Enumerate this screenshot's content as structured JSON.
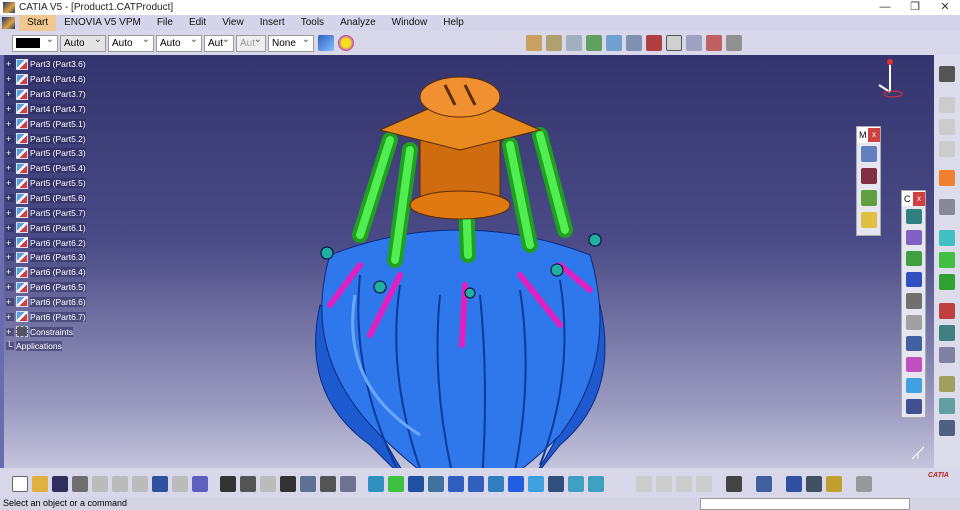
{
  "window": {
    "title": "CATIA V5 - [Product1.CATProduct]",
    "controls": [
      "—",
      "❐",
      "✕"
    ]
  },
  "menu": [
    "Start",
    "ENOVIA V5 VPM",
    "File",
    "Edit",
    "View",
    "Insert",
    "Tools",
    "Analyze",
    "Window",
    "Help"
  ],
  "graphic_props": {
    "color": "",
    "line_type": "Auto",
    "thickness": "Auto",
    "linetype2": "Auto",
    "layer_a": "Aut",
    "layer_b": "Aut",
    "layer": "None"
  },
  "tree": [
    "Part3 (Part3.6)",
    "Part4 (Part4.6)",
    "Part3 (Part3.7)",
    "Part4 (Part4.7)",
    "Part5 (Part5.1)",
    "Part5 (Part5.2)",
    "Part5 (Part5.3)",
    "Part5 (Part5.4)",
    "Part5 (Part5.5)",
    "Part5 (Part5.6)",
    "Part5 (Part5.7)",
    "Part6 (Part6.1)",
    "Part6 (Part6.2)",
    "Part6 (Part6.3)",
    "Part6 (Part6.4)",
    "Part6 (Part6.5)",
    "Part6 (Part6.6)",
    "Part6 (Part6.7)",
    "Constraints",
    "Applications"
  ],
  "floating_toolbars": [
    {
      "title": "M",
      "close": "x"
    },
    {
      "title": "C",
      "close": "x"
    }
  ],
  "status": {
    "message": "Select an object or a command"
  },
  "brand": "CATIA",
  "colors": {
    "hub": "#e07a10",
    "cylinder": "#30d030",
    "rod": "#e020c0",
    "petal": "#2a70e0"
  }
}
